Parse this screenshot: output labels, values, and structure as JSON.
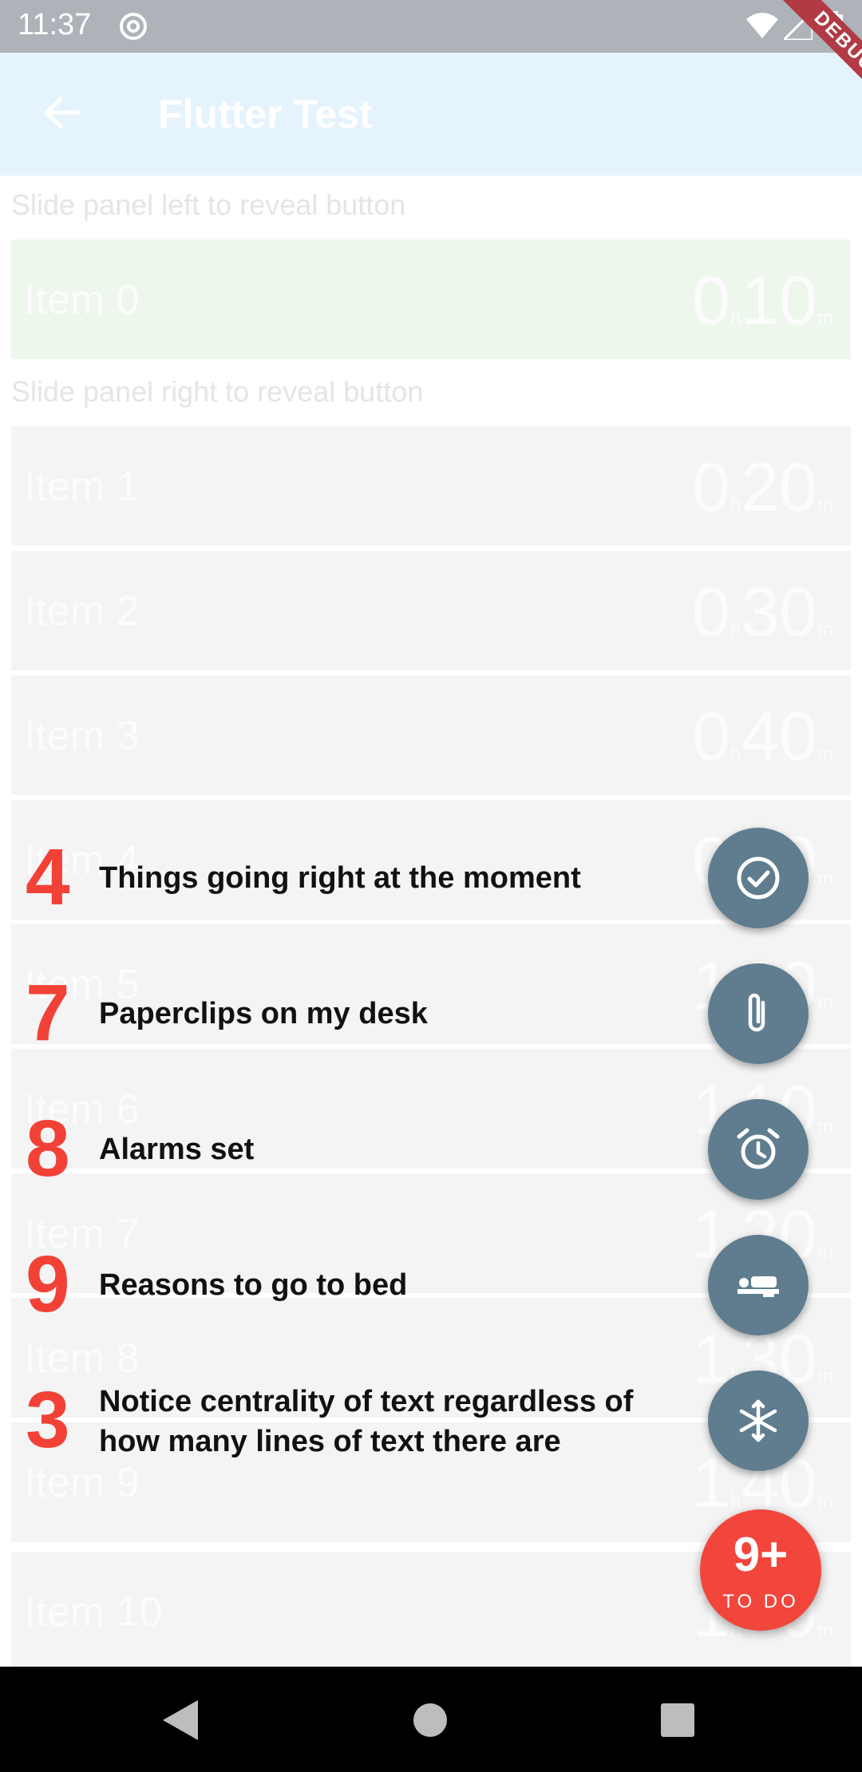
{
  "status_bar": {
    "time": "11:37"
  },
  "debug_banner": "DEBUG",
  "app_bar": {
    "title": "Flutter Test"
  },
  "hints": {
    "left": "Slide panel left to reveal button",
    "right": "Slide panel right to reveal button"
  },
  "list_items": [
    {
      "label": "Item 0",
      "hours": "0",
      "minutes": "10",
      "h_unit": "h",
      "m_unit": "m"
    },
    {
      "label": "Item 1",
      "hours": "0",
      "minutes": "20",
      "h_unit": "h",
      "m_unit": "m"
    },
    {
      "label": "Item 2",
      "hours": "0",
      "minutes": "30",
      "h_unit": "h",
      "m_unit": "m"
    },
    {
      "label": "Item 3",
      "hours": "0",
      "minutes": "40",
      "h_unit": "h",
      "m_unit": "m"
    },
    {
      "label": "Item 4",
      "hours": "0",
      "minutes": "50",
      "h_unit": "h",
      "m_unit": "m"
    },
    {
      "label": "Item 5",
      "hours": "1",
      "minutes": "00",
      "h_unit": "h",
      "m_unit": "m"
    },
    {
      "label": "Item 6",
      "hours": "1",
      "minutes": "10",
      "h_unit": "h",
      "m_unit": "m"
    },
    {
      "label": "Item 7",
      "hours": "1",
      "minutes": "20",
      "h_unit": "h",
      "m_unit": "m"
    },
    {
      "label": "Item 8",
      "hours": "1",
      "minutes": "30",
      "h_unit": "h",
      "m_unit": "m"
    },
    {
      "label": "Item 9",
      "hours": "1",
      "minutes": "40",
      "h_unit": "h",
      "m_unit": "m"
    },
    {
      "label": "Item 10",
      "hours": "1",
      "minutes": "50",
      "h_unit": "h",
      "m_unit": "m"
    }
  ],
  "overlay_items": [
    {
      "count": "4",
      "text": "Things going right at the moment",
      "icon": "check-circle-icon"
    },
    {
      "count": "7",
      "text": "Paperclips on my desk",
      "icon": "paperclip-icon"
    },
    {
      "count": "8",
      "text": "Alarms set",
      "icon": "alarm-clock-icon"
    },
    {
      "count": "9",
      "text": "Reasons to go to bed",
      "icon": "bed-icon"
    },
    {
      "count": "3",
      "text": "Notice centrality of text regardless of how many lines of text there are",
      "icon": "snowflake-icon"
    }
  ],
  "todo_fab": {
    "count": "9+",
    "label": "TO DO"
  },
  "colors": {
    "accent_red": "#f24136",
    "fab_gray": "#5f7d8f",
    "app_bar_bg": "#e5f3fd",
    "status_bar_bg": "#aeb3ba"
  }
}
